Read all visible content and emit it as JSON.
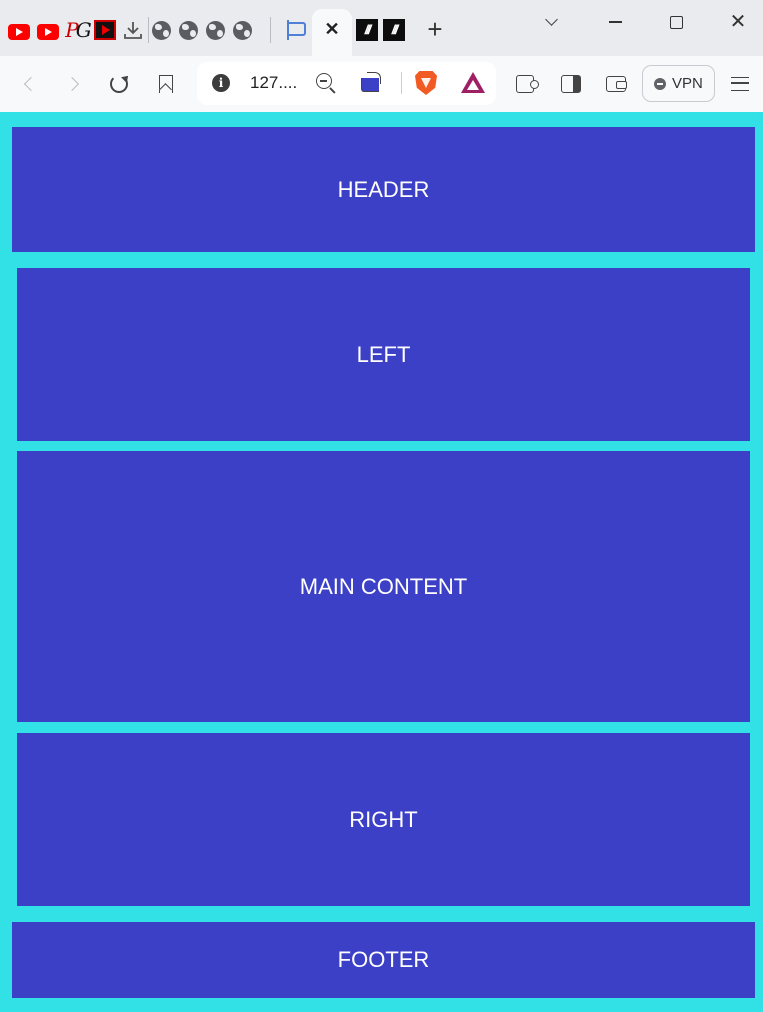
{
  "browser": {
    "tabs": [
      {
        "icon": "youtube-icon"
      },
      {
        "icon": "youtube-icon"
      },
      {
        "icon": "pg-logo-icon",
        "text_p": "P",
        "text_g": "G"
      },
      {
        "icon": "red-video-icon"
      },
      {
        "icon": "download-icon"
      },
      {
        "icon": "globe-icon"
      },
      {
        "icon": "globe-icon"
      },
      {
        "icon": "globe-icon"
      },
      {
        "icon": "globe-icon"
      },
      {
        "icon": "flag-icon"
      },
      {
        "icon": "close-icon",
        "active": true,
        "close_glyph": "✕"
      },
      {
        "icon": "mm-logo-icon",
        "text": "///"
      },
      {
        "icon": "mm-logo-icon",
        "text": "///"
      }
    ],
    "new_tab_glyph": "+",
    "window_controls": {
      "close_glyph": "✕"
    },
    "address": {
      "text": "127...."
    },
    "vpn_label": "VPN",
    "accent": "#f15a22"
  },
  "page": {
    "background": "#31e1e6",
    "box_color": "#3c40c6",
    "sections": {
      "header": "HEADER",
      "left": "LEFT",
      "main": "MAIN CONTENT",
      "right": "RIGHT",
      "footer": "FOOTER"
    }
  }
}
